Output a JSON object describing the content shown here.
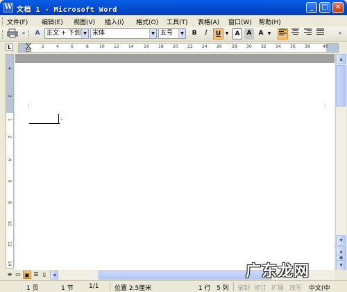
{
  "window": {
    "title": "文档 1 - Microsoft Word",
    "app_icon": "W",
    "min": "_",
    "max": "□",
    "close": "✕"
  },
  "menu": [
    "文件(F)",
    "编辑(E)",
    "视图(V)",
    "插入(I)",
    "格式(O)",
    "工具(T)",
    "表格(A)",
    "窗口(W)",
    "帮助(H)"
  ],
  "toolbar": {
    "style_value": "正文 + 下划",
    "font_value": "宋体",
    "size_value": "五号",
    "bold": "B",
    "italic": "I",
    "underline": "U",
    "font_color": "A",
    "highlight": "A",
    "char_border": "A"
  },
  "ruler": {
    "corner": "L",
    "numbers": [
      "2",
      "4",
      "6",
      "8",
      "10",
      "12",
      "14",
      "16",
      "18",
      "20",
      "22",
      "24",
      "26",
      "28",
      "30",
      "32",
      "34",
      "36",
      "38",
      "40"
    ],
    "v_numbers": [
      "4",
      "2",
      "1",
      "2",
      "4",
      "6",
      "8",
      "10",
      "12",
      "14"
    ]
  },
  "status": {
    "page": "1 页",
    "section": "1 节",
    "page_of": "1/1",
    "position": "位置 2.5厘米",
    "line": "1 行",
    "column": "5 列",
    "rec": "录制",
    "trk": "修订",
    "ext": "扩展",
    "ovr": "改写",
    "lang": "中文(中"
  },
  "watermark": "广东龙网"
}
